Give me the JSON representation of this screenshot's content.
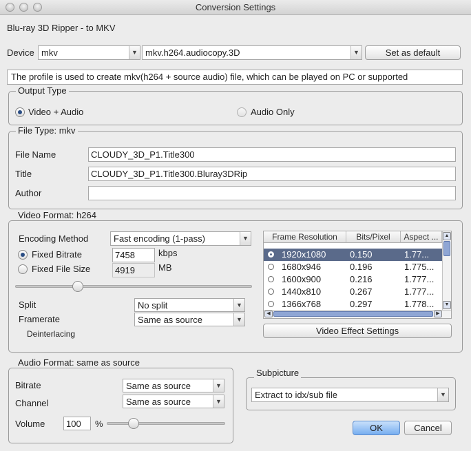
{
  "window": {
    "title": "Conversion Settings"
  },
  "heading": "Blu-ray 3D Ripper - to MKV",
  "device": {
    "label": "Device",
    "value": "mkv",
    "profile": "mkv.h264.audiocopy.3D",
    "default_button": "Set as default",
    "description": "The profile is used to create mkv(h264 + source audio) file, which can be played on PC or supported"
  },
  "output_type": {
    "legend": "Output Type",
    "options": [
      "Video + Audio",
      "Audio Only"
    ],
    "selected": "Video + Audio"
  },
  "file_type": {
    "legend": "File Type: mkv",
    "file_name_label": "File Name",
    "file_name": "CLOUDY_3D_P1.Title300",
    "title_label": "Title",
    "title": "CLOUDY_3D_P1.Title300.Bluray3DRip",
    "author_label": "Author",
    "author": ""
  },
  "video_format": {
    "legend": "Video Format: h264",
    "encoding_label": "Encoding Method",
    "encoding": "Fast encoding (1-pass)",
    "fixed_bitrate_label": "Fixed Bitrate",
    "fixed_bitrate": "7458",
    "bitrate_unit": "kbps",
    "fixed_size_label": "Fixed File Size",
    "fixed_size": "4919",
    "size_unit": "MB",
    "selected_mode": "Fixed Bitrate",
    "split_label": "Split",
    "split": "No split",
    "framerate_label": "Framerate",
    "framerate": "Same as source",
    "deinterlacing_label": "Deinterlacing",
    "effect_button": "Video Effect Settings",
    "table": {
      "headers": [
        "Frame Resolution",
        "Bits/Pixel",
        "Aspect ..."
      ],
      "rows": [
        {
          "resolution": "1920x1080",
          "bits": "0.150",
          "aspect": "1.77...",
          "selected": true
        },
        {
          "resolution": "1680x946",
          "bits": "0.196",
          "aspect": "1.775...",
          "selected": false
        },
        {
          "resolution": "1600x900",
          "bits": "0.216",
          "aspect": "1.777...",
          "selected": false
        },
        {
          "resolution": "1440x810",
          "bits": "0.267",
          "aspect": "1.777...",
          "selected": false
        },
        {
          "resolution": "1366x768",
          "bits": "0.297",
          "aspect": "1.778...",
          "selected": false
        }
      ]
    }
  },
  "audio_format": {
    "legend": "Audio Format: same as source",
    "bitrate_label": "Bitrate",
    "bitrate": "Same as source",
    "channel_label": "Channel",
    "channel": "Same as source",
    "volume_label": "Volume",
    "volume": "100",
    "volume_unit": "%"
  },
  "subpicture": {
    "legend": "Subpicture",
    "value": "Extract to idx/sub file"
  },
  "buttons": {
    "ok": "OK",
    "cancel": "Cancel"
  },
  "colors": {
    "selection": "#5a6a8a",
    "ok_button": "#77aef0"
  }
}
